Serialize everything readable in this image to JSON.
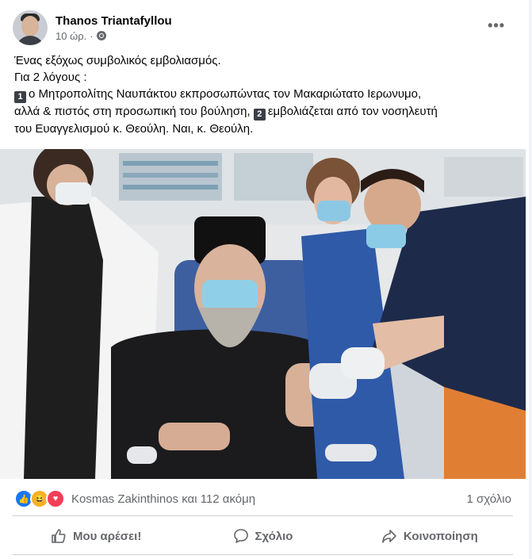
{
  "post": {
    "author": "Thanos Triantafyllou",
    "time": "10 ώρ.",
    "dot": "·",
    "more": "•••",
    "text": {
      "line1": "Ένας εξόχως συμβολικός εμβολιασμός.",
      "line2": "Για 2 λόγους :",
      "badge1": "1",
      "line3": "ο Μητροπολίτης Ναυπάκτου εκπροσωπώντας τον Μακαριώτατο Ιερωνυμο,",
      "line4a": "αλλά & πιστός στη προσωπική του βούληση, ",
      "badge2": "2",
      "line4b": "εμβολιάζεται από τον νοσηλευτή",
      "line5": "του Ευαγγελισμού κ. Θεούλη. Ναι, κ. Θεούλη."
    }
  },
  "reactions": {
    "summary": "Kosmas Zakinthinos και 112 ακόμη",
    "comments": "1 σχόλιο",
    "icons": [
      "like-icon",
      "haha-icon",
      "love-icon"
    ],
    "colors": {
      "like": "#1877f2",
      "haha": "#f7b125",
      "love": "#f33e58"
    }
  },
  "actions": {
    "like": "Μου αρέσει!",
    "comment": "Σχόλιο",
    "share": "Κοινοποίηση"
  }
}
